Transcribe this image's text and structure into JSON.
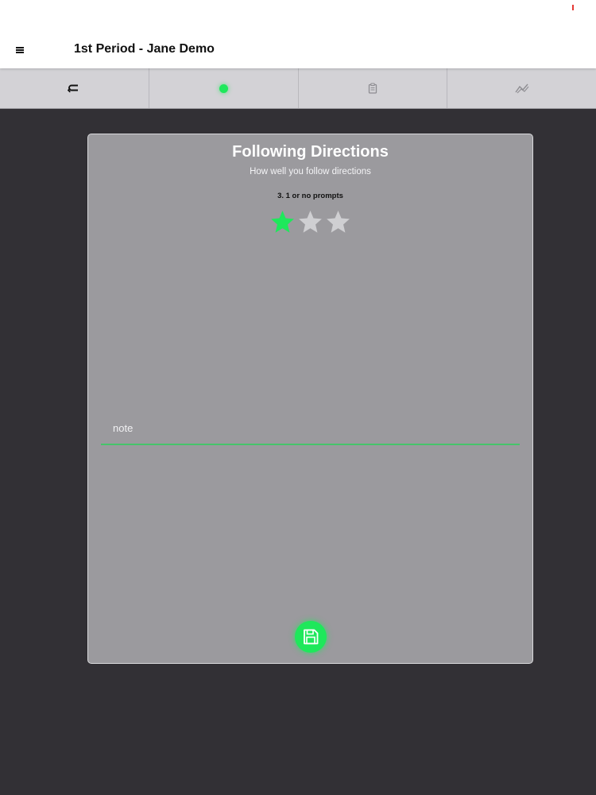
{
  "header": {
    "title": "1st Period - Jane Demo",
    "menu_icon": "hamburger-icon"
  },
  "tabs": [
    {
      "icon": "return-icon"
    },
    {
      "icon": "green-dot-icon",
      "active": true
    },
    {
      "icon": "clipboard-icon"
    },
    {
      "icon": "trend-chart-icon"
    }
  ],
  "card": {
    "title": "Following Directions",
    "subtitle": "How well you follow directions",
    "rating_label": "3. 1 or no prompts",
    "rating": {
      "filled": 1,
      "total": 3
    },
    "note_placeholder": "note",
    "save_icon": "save-icon"
  },
  "colors": {
    "accent_green": "#1ee85b",
    "card_background": "#9b9a9e",
    "page_background": "#323035",
    "star_empty": "#cfcfd2"
  }
}
